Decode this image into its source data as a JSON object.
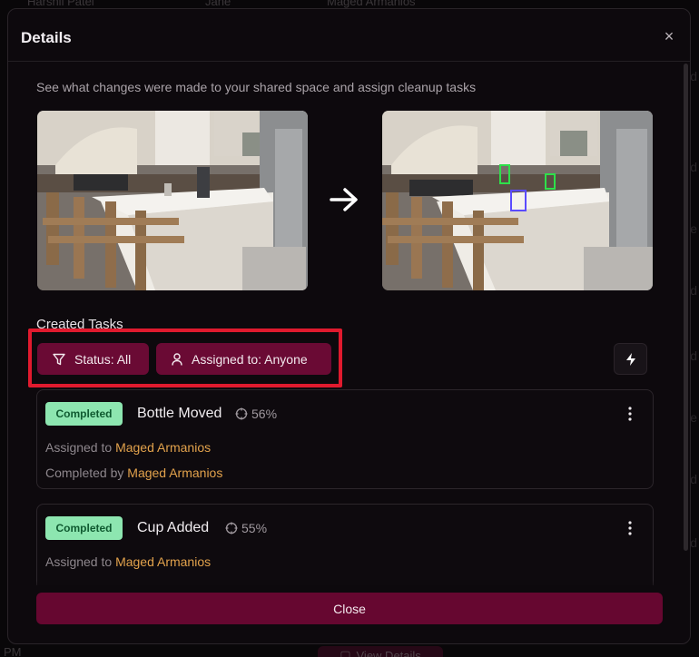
{
  "background": {
    "user_names": [
      "Harshil Patel",
      "Jane",
      "Maged Armanios"
    ],
    "edge_glyphs": [
      "d",
      "d",
      "e",
      "d",
      "d",
      "e",
      "d",
      "d"
    ],
    "bottom_left_text": "PM",
    "view_details_label": "View Details"
  },
  "modal": {
    "title": "Details",
    "close_icon": "close-icon",
    "subtitle": "See what changes were made to your shared space and assign cleanup tasks",
    "images": {
      "before_icon": "kitchen-photo-before",
      "arrow_icon": "arrow-right-icon",
      "after_icon": "kitchen-photo-after"
    },
    "tasks_section": {
      "title": "Created Tasks",
      "filters": {
        "status_label": "Status: All",
        "status_icon": "filter-icon",
        "assigned_label": "Assigned to: Anyone",
        "assigned_icon": "user-icon"
      },
      "bolt_icon": "lightning-icon"
    },
    "tasks": [
      {
        "status": "Completed",
        "name": "Bottle Moved",
        "confidence": "56%",
        "assigned_prefix": "Assigned to",
        "assigned_to": "Maged Armanios",
        "completed_prefix": "Completed by",
        "completed_by": "Maged Armanios"
      },
      {
        "status": "Completed",
        "name": "Cup Added",
        "confidence": "55%",
        "assigned_prefix": "Assigned to",
        "assigned_to": "Maged Armanios"
      }
    ],
    "close_button_label": "Close"
  },
  "colors": {
    "accent": "#6a0a34",
    "highlight": "#e01a2e",
    "badge_bg": "#8de6b0",
    "badge_text": "#0f5a30",
    "person_link": "#e2a24c"
  }
}
